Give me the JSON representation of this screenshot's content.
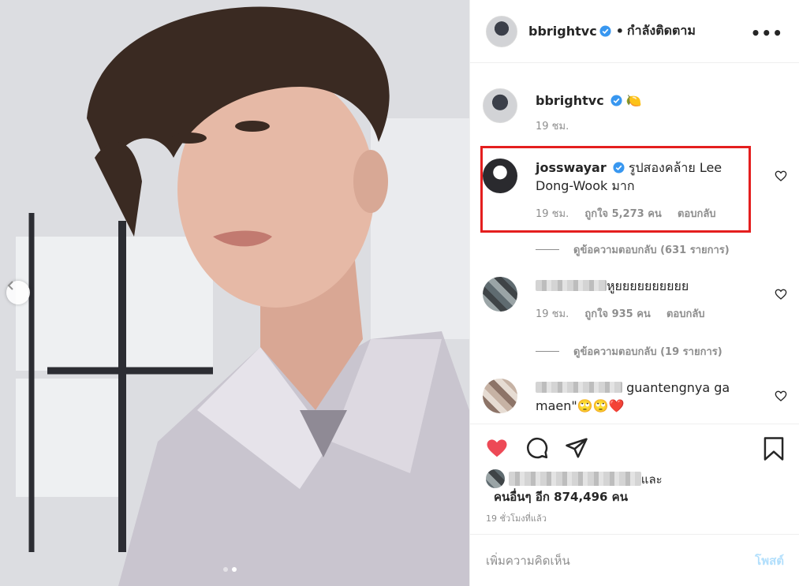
{
  "photo": {
    "carousel_dots": 2,
    "active_dot": 2
  },
  "header": {
    "username": "bbrightvc",
    "separator": "•",
    "follow_status": "กำลังติดตาม"
  },
  "caption": {
    "username": "bbrightvc",
    "emoji": "🍋",
    "time": "19 ชม."
  },
  "comments": [
    {
      "username": "josswayar",
      "text": "รูปสองคล้าย Lee Dong-Wook มาก",
      "time": "19 ชม.",
      "likes": "ถูกใจ 5,273 คน",
      "reply": "ตอบกลับ",
      "view_replies": "ดูข้อความตอบกลับ (631 รายการ)"
    },
    {
      "username": "",
      "text": "หูยยยยยยยยยย",
      "time": "19 ชม.",
      "likes": "ถูกใจ 935 คน",
      "reply": "ตอบกลับ",
      "view_replies": "ดูข้อความตอบกลับ (19 รายการ)"
    },
    {
      "username": "",
      "text_a": "guantengnya ga",
      "text_b": "maen\"🙄🙄❤️"
    }
  ],
  "likes": {
    "suffix": "และ",
    "others": "คนอื่นๆ อีก 874,496 คน"
  },
  "timestamp": "19 ชั่วโมงที่แล้ว",
  "add_comment": {
    "placeholder": "เพิ่มความคิดเห็น",
    "post_label": "โพสต์"
  },
  "colors": {
    "verified": "#3897f0",
    "like_red": "#ed4956",
    "highlight": "#e41e1e",
    "post_disabled": "#b2dffc"
  }
}
